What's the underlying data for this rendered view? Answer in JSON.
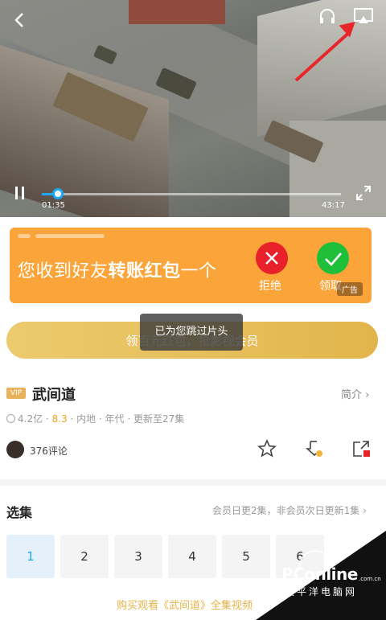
{
  "player": {
    "current_time": "01:35",
    "total_time": "43:17",
    "progress_fraction": 0.055
  },
  "ad": {
    "message_prefix": "您收到好友",
    "message_bold": "转账红包",
    "message_suffix": "一个",
    "reject_label": "拒绝",
    "accept_label": "领取",
    "badge": "广告"
  },
  "vip_cta": {
    "label": "领百元红包，抢影视会员"
  },
  "toast": {
    "label": "已为您跳过片头"
  },
  "show": {
    "vip_tag": "VIP",
    "title": "武间道",
    "intro_link": "简介",
    "plays": "4.2亿",
    "score": "8.3",
    "meta_rest": "· 内地 · 年代 · 更新至27集",
    "comments": "376评论"
  },
  "episodes": {
    "section_title": "选集",
    "update_info": "会员日更2集，非会员次日更新1集",
    "items": [
      "1",
      "2",
      "3",
      "4",
      "5",
      "6"
    ],
    "buy_link": "购买观看《武间道》全集视频"
  },
  "watermark": {
    "brand": "PConline",
    "domain": ".com.cn",
    "sub": "太平洋电脑网"
  },
  "colors": {
    "accent_blue": "#1fa7f0",
    "ad_orange": "#fba43a",
    "gold": "#e7b34a",
    "reject_red": "#e8202a",
    "accept_green": "#1fbf3a",
    "annotation_red": "#e8262a"
  },
  "icons": [
    "back-icon",
    "headphones-icon",
    "cast-icon",
    "pause-icon",
    "fullscreen-icon",
    "star-icon",
    "download-icon",
    "share-icon",
    "chevron-right-icon"
  ]
}
